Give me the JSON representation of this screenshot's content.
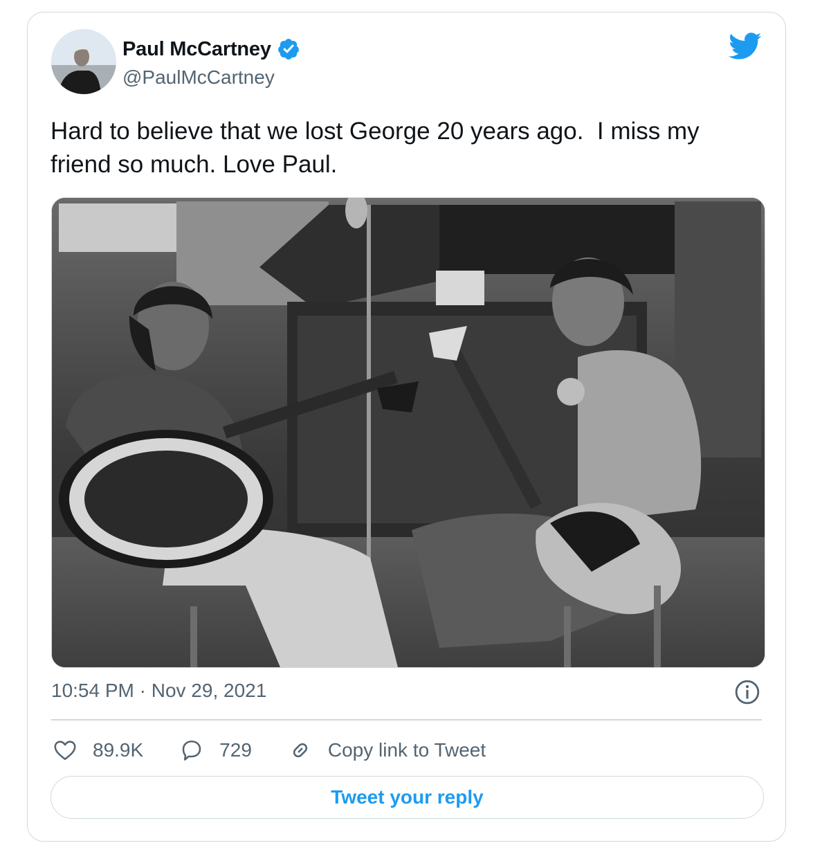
{
  "tweet": {
    "author_name": "Paul McCartney",
    "author_handle": "@PaulMcCartney",
    "text": "Hard to believe that we lost George 20 years ago.  I miss my friend so much. Love Paul.",
    "timestamp": "10:54 PM · Nov 29, 2021",
    "verified": true
  },
  "actions": {
    "like_count": "89.9K",
    "reply_count": "729",
    "copy_link_label": "Copy link to Tweet",
    "reply_button_label": "Tweet your reply"
  },
  "icons": {
    "brand": "twitter-bird-icon",
    "verified": "verified-badge-icon",
    "info": "info-icon",
    "like": "heart-icon",
    "reply": "speech-bubble-icon",
    "copy_link": "link-icon"
  },
  "colors": {
    "accent": "#1d9bf0",
    "text_primary": "#0f1419",
    "text_secondary": "#536471",
    "border": "#cfd9de"
  }
}
